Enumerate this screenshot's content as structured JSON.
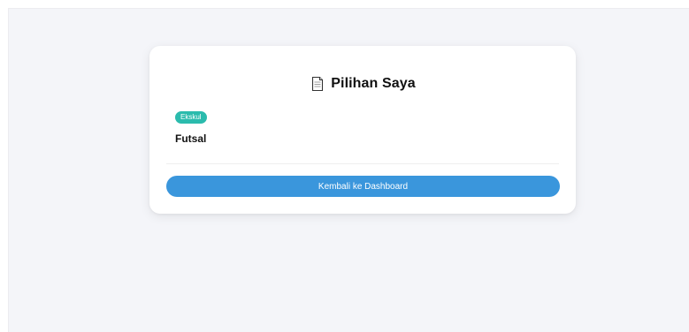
{
  "card": {
    "title_icon": "document-icon",
    "title": "Pilihan Saya",
    "selections": [
      {
        "category": "Ekskul",
        "name": "Futsal"
      }
    ],
    "back_button_label": "Kembali ke Dashboard"
  },
  "colors": {
    "page_background": "#f4f5f9",
    "badge": "#2bbbad",
    "button": "#3a96dc"
  }
}
